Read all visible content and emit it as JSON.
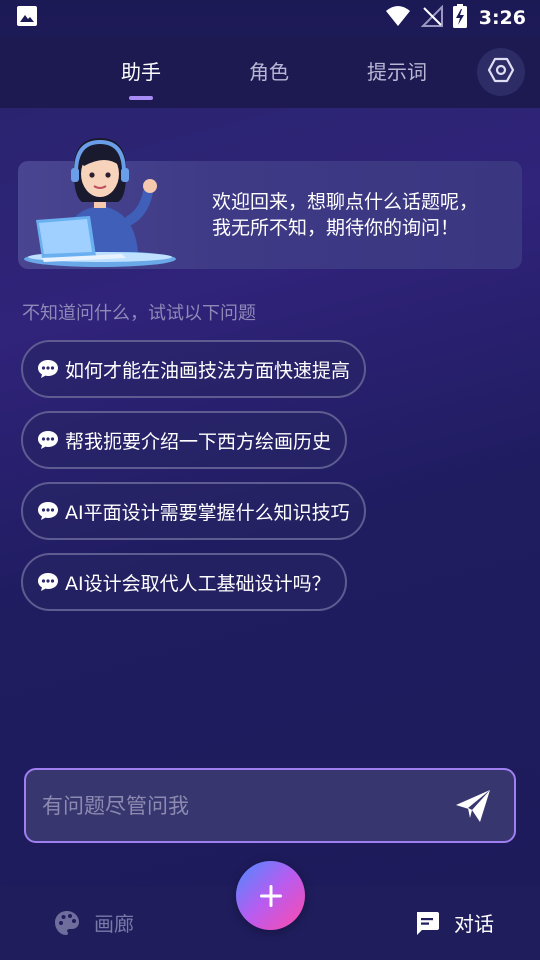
{
  "status_bar": {
    "time": "3:26",
    "icons": [
      "image-icon",
      "wifi-icon",
      "no-signal-icon",
      "battery-charging-icon"
    ]
  },
  "top_nav": {
    "tabs": [
      {
        "label": "助手",
        "active": true
      },
      {
        "label": "角色",
        "active": false
      },
      {
        "label": "提示词",
        "active": false
      }
    ],
    "settings_icon": "settings-icon"
  },
  "welcome": {
    "line1": "欢迎回来，想聊点什么话题呢，",
    "line2": "我无所不知，期待你的询问！",
    "avatar": "assistant-avatar-illustration"
  },
  "suggestions": {
    "hint": "不知道问什么，试试以下问题",
    "items": [
      "如何才能在油画技法方面快速提高",
      "帮我扼要介绍一下西方绘画历史",
      "AI平面设计需要掌握什么知识技巧",
      "AI设计会取代人工基础设计吗？"
    ],
    "icon": "chat-bubble-icon"
  },
  "input": {
    "placeholder": "有问题尽管问我",
    "value": "",
    "send_icon": "send-icon"
  },
  "bottom_nav": {
    "items": [
      {
        "label": "画廊",
        "icon": "palette-icon",
        "active": false
      },
      {
        "label": "对话",
        "icon": "chat-icon",
        "active": true
      }
    ],
    "fab_icon": "plus-icon"
  },
  "colors": {
    "accent": "#a07ff0",
    "background": "#1e1b5e",
    "tab_inactive": "#b9b7d6"
  }
}
